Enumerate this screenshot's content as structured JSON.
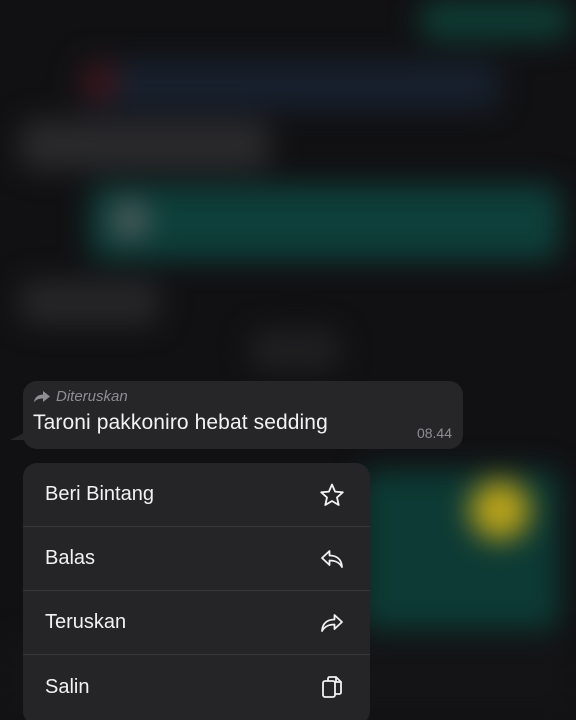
{
  "message": {
    "forwarded_label": "Diteruskan",
    "text": "Taroni pakkoniro hebat sedding",
    "time": "08.44"
  },
  "menu": {
    "items": [
      {
        "label": "Beri Bintang",
        "icon": "star-icon"
      },
      {
        "label": "Balas",
        "icon": "reply-icon"
      },
      {
        "label": "Teruskan",
        "icon": "forward-icon"
      },
      {
        "label": "Salin",
        "icon": "copy-icon"
      }
    ]
  },
  "colors": {
    "background": "#111113",
    "bubble": "#262628",
    "menu": "#252527",
    "text": "#f2f2f2",
    "secondary_text": "#8e8e93"
  }
}
